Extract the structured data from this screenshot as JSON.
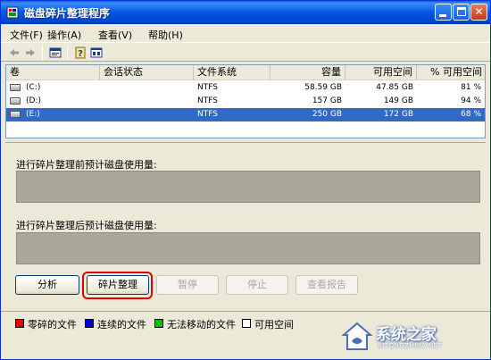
{
  "window": {
    "title": "磁盘碎片整理程序"
  },
  "menu": [
    "文件(F)",
    "操作(A)",
    "查看(V)",
    "帮助(H)"
  ],
  "list": {
    "columns": [
      "卷",
      "会话状态",
      "文件系统",
      "容量",
      "可用空间",
      "% 可用空间"
    ],
    "rows": [
      {
        "volume": "(C:)",
        "status": "",
        "fs": "NTFS",
        "capacity": "58.59 GB",
        "free": "47.85 GB",
        "pct": "81 %"
      },
      {
        "volume": "(D:)",
        "status": "",
        "fs": "NTFS",
        "capacity": "157 GB",
        "free": "149 GB",
        "pct": "94 %"
      },
      {
        "volume": "(E:)",
        "status": "",
        "fs": "NTFS",
        "capacity": "250 GB",
        "free": "172 GB",
        "pct": "68 %"
      }
    ],
    "selected_row": 2
  },
  "usage": {
    "before_label": "进行碎片整理前预计磁盘使用量:",
    "after_label": "进行碎片整理后预计磁盘使用量:"
  },
  "buttons": {
    "analyze": "分析",
    "defragment": "碎片整理",
    "pause": "暂停",
    "stop": "停止",
    "report": "查看报告"
  },
  "legend": [
    {
      "label": "零碎的文件",
      "color": "#e00000"
    },
    {
      "label": "连续的文件",
      "color": "#0000e0"
    },
    {
      "label": "无法移动的文件",
      "color": "#00c000"
    },
    {
      "label": "可用空间",
      "color": "#ffffff"
    }
  ],
  "watermark": {
    "name": "系统之家",
    "url": "XITONGZHIJIA.NET"
  },
  "colors": {
    "selection": "#316ac5",
    "usage_bar": "#aca899",
    "highlight": "#e00000",
    "titlebar": "#0055e5"
  },
  "icons": [
    "app-defrag-icon",
    "back-arrow-icon",
    "forward-arrow-icon",
    "properties-icon",
    "help-icon",
    "console-icon",
    "drive-icon"
  ]
}
